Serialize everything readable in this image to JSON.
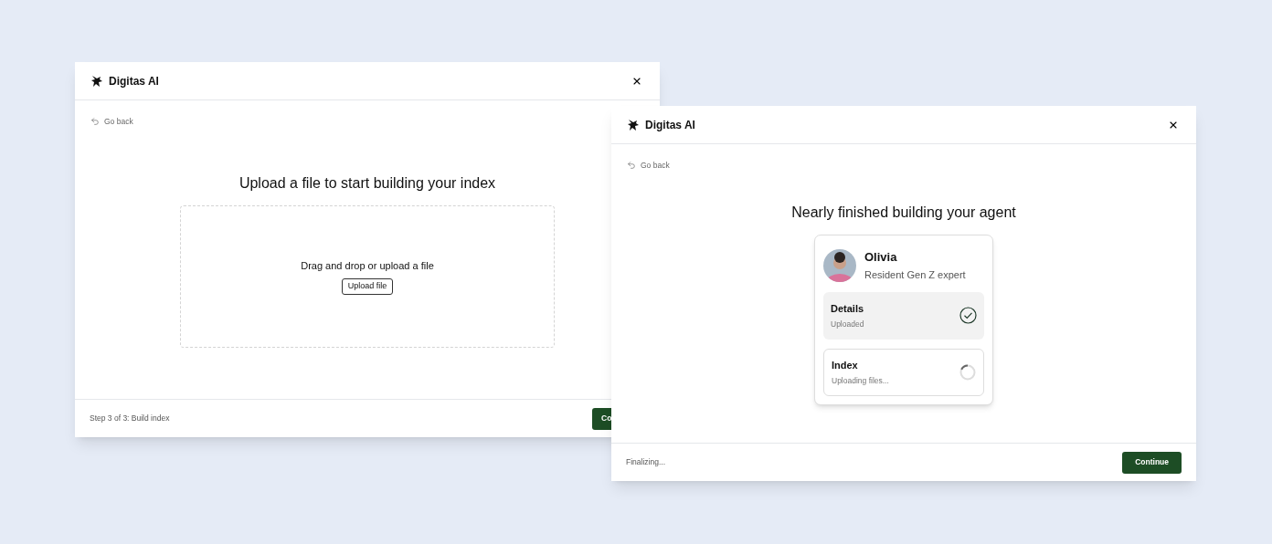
{
  "windows": [
    {
      "kind": "upload",
      "title": "Digitas AI",
      "back": "Go back",
      "heading": "Upload a file to start building your index",
      "dropzone": {
        "text": "Drag and drop or upload a file",
        "button": "Upload file"
      },
      "footer": {
        "status": "Step 3 of 3: Build index",
        "button": "Co"
      }
    },
    {
      "kind": "agent",
      "title": "Digitas AI",
      "back": "Go back",
      "heading": "Nearly finished building your agent",
      "agent": {
        "name": "Olivia",
        "role": "Resident Gen Z expert",
        "steps": [
          {
            "title": "Details",
            "subtitle": "Uploaded",
            "kind": "done"
          },
          {
            "title": "Index",
            "subtitle": "Uploading files...",
            "kind": "loading"
          }
        ]
      },
      "footer": {
        "status": "Finalizing...",
        "button": "Continue"
      }
    }
  ]
}
